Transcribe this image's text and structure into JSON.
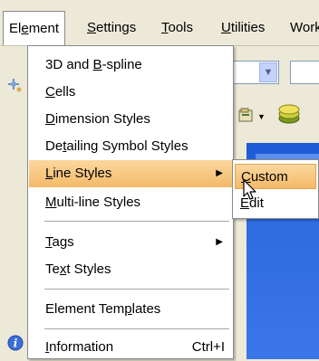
{
  "menubar": {
    "items": [
      {
        "label": "Element",
        "mnemonic_index": 2
      },
      {
        "label": "Settings",
        "mnemonic_index": 0
      },
      {
        "label": "Tools",
        "mnemonic_index": 0
      },
      {
        "label": "Utilities",
        "mnemonic_index": 0
      },
      {
        "label": "Work",
        "mnemonic_index": -1
      }
    ]
  },
  "element_menu": {
    "items": [
      {
        "pre": "3D and ",
        "u": "B",
        "post": "-spline"
      },
      {
        "pre": "",
        "u": "C",
        "post": "ells"
      },
      {
        "pre": "",
        "u": "D",
        "post": "imension Styles"
      },
      {
        "pre": "De",
        "u": "t",
        "post": "ailing Symbol Styles"
      },
      {
        "pre": "",
        "u": "L",
        "post": "ine Styles"
      },
      {
        "pre": "",
        "u": "M",
        "post": "ulti-line Styles"
      },
      {
        "pre": "",
        "u": "T",
        "post": "ags"
      },
      {
        "pre": "Te",
        "u": "x",
        "post": "t Styles"
      },
      {
        "pre": "Element Tem",
        "u": "p",
        "post": "lates"
      },
      {
        "pre": "",
        "u": "I",
        "post": "nformation"
      }
    ],
    "information_shortcut": "Ctrl+I"
  },
  "line_styles_submenu": {
    "items": [
      {
        "pre": "",
        "u": "C",
        "post": "ustom"
      },
      {
        "pre": "",
        "u": "E",
        "post": "dit"
      }
    ]
  },
  "colors": {
    "highlight": "#f4c17a",
    "toolbar_blue": "#2e6ae0",
    "menu_bg": "#ffffff",
    "chrome": "#ece9d8"
  }
}
